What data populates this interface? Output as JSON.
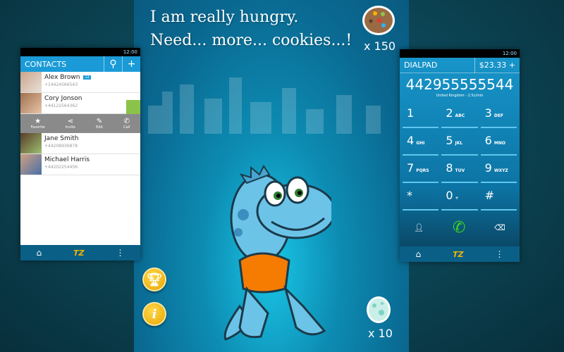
{
  "game": {
    "headline_line1": "I am really hungry.",
    "headline_line2": "Need... more... cookies...!",
    "cookie_count": "x 150",
    "egg_count": "x 10",
    "trophy_icon": "trophy-icon",
    "info_label": "i"
  },
  "contacts_phone": {
    "status_time": "12:00",
    "title": "CONTACTS",
    "search_icon": "search-icon",
    "add_label": "+",
    "contacts": [
      {
        "name": "Alex Brown",
        "phone": "+14424566543",
        "badge": "12"
      },
      {
        "name": "Cory Jonson",
        "phone": "+44122564362"
      },
      {
        "name": "Jane Smith",
        "phone": "+44208936878"
      },
      {
        "name": "Michael Harris",
        "phone": "+44202254456"
      }
    ],
    "actions": [
      {
        "icon": "★",
        "label": "Favorite"
      },
      {
        "icon": "⋖",
        "label": "Invite"
      },
      {
        "icon": "✎",
        "label": "Edit"
      },
      {
        "icon": "✆",
        "label": "Call"
      }
    ],
    "nav": {
      "home": "⌂",
      "logo": "TZ",
      "menu": "⋮"
    }
  },
  "dialpad_phone": {
    "status_time": "12:00",
    "title": "DIALPAD",
    "balance": "$23.33",
    "add_label": "+",
    "number": "442955555544",
    "rate": "United Kingdom - 2.5c/min",
    "keys": [
      {
        "d": "1",
        "l": ""
      },
      {
        "d": "2",
        "l": "ABC"
      },
      {
        "d": "3",
        "l": "DEF"
      },
      {
        "d": "4",
        "l": "GHI"
      },
      {
        "d": "5",
        "l": "JKL"
      },
      {
        "d": "6",
        "l": "MNO"
      },
      {
        "d": "7",
        "l": "PQRS"
      },
      {
        "d": "8",
        "l": "TUV"
      },
      {
        "d": "9",
        "l": "WXYZ"
      },
      {
        "d": "*",
        "l": ""
      },
      {
        "d": "0",
        "l": "+"
      },
      {
        "d": "#",
        "l": ""
      }
    ],
    "nav": {
      "home": "⌂",
      "logo": "TZ",
      "menu": "⋮"
    },
    "colors": {
      "call_green": "#3ddc1a",
      "accent": "#1a9bd7"
    }
  }
}
